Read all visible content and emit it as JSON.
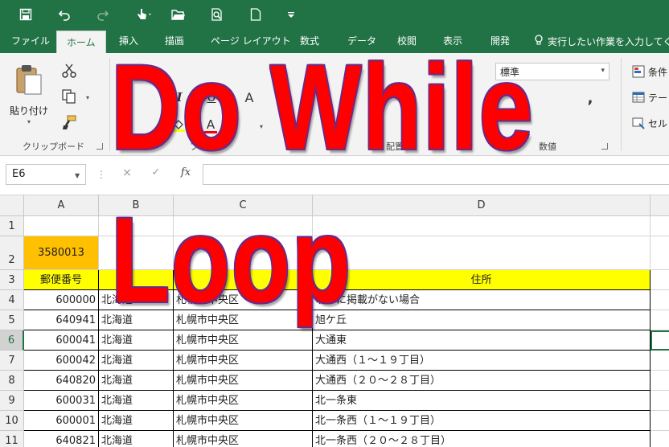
{
  "ribbon_tabs": [
    "ファイル",
    "ホーム",
    "挿入",
    "描画",
    "ページ レイアウト",
    "数式",
    "データ",
    "校閲",
    "表示",
    "開発"
  ],
  "tell_me": "実行したい作業を入力してください",
  "clipboard": {
    "paste_label": "貼り付け",
    "group_label": "クリップボード"
  },
  "font_group": {
    "group_label": "フォント",
    "italic": "I",
    "underline": "U",
    "grow": "A",
    "font_color": "A"
  },
  "alignment_group": {
    "group_label": "配置"
  },
  "number_group": {
    "format_value": "標準",
    "group_label": "数値",
    "comma": ","
  },
  "styles_group": {
    "items": [
      "条件",
      "テー",
      "セル"
    ]
  },
  "formula_bar": {
    "name_box": "E6",
    "cancel": "×",
    "enter": "✓",
    "fx": "fx",
    "formula": ""
  },
  "columns": [
    "A",
    "B",
    "C",
    "D"
  ],
  "rows": [
    {
      "num": "1",
      "a": "",
      "b": "",
      "c": "",
      "d": ""
    },
    {
      "num": "2",
      "a": "3580013",
      "b": "",
      "c": "",
      "d": ""
    },
    {
      "num": "3",
      "a": "郵便番号",
      "b": "",
      "c": "",
      "d": "住所"
    },
    {
      "num": "4",
      "a": "600000",
      "b": "北海道",
      "c": "札幌市中央区",
      "d": "以下に掲載がない場合"
    },
    {
      "num": "5",
      "a": "640941",
      "b": "北海道",
      "c": "札幌市中央区",
      "d": "旭ケ丘"
    },
    {
      "num": "6",
      "a": "600041",
      "b": "北海道",
      "c": "札幌市中央区",
      "d": "大通東"
    },
    {
      "num": "7",
      "a": "600042",
      "b": "北海道",
      "c": "札幌市中央区",
      "d": "大通西（１～１９丁目）"
    },
    {
      "num": "8",
      "a": "640820",
      "b": "北海道",
      "c": "札幌市中央区",
      "d": "大通西（２０～２８丁目）"
    },
    {
      "num": "9",
      "a": "600031",
      "b": "北海道",
      "c": "札幌市中央区",
      "d": "北一条東"
    },
    {
      "num": "10",
      "a": "600001",
      "b": "北海道",
      "c": "札幌市中央区",
      "d": "北一条西（１～１９丁目）"
    },
    {
      "num": "11",
      "a": "640821",
      "b": "北海道",
      "c": "札幌市中央区",
      "d": "北一条西（２０～２８丁目）"
    }
  ],
  "overlay": {
    "line1": "Do While",
    "line2": "Loop"
  },
  "colors": {
    "excel_green": "#217346",
    "header_yellow": "#ffff00",
    "cell_orange": "#ffc000",
    "overlay_red": "#ff0000"
  }
}
